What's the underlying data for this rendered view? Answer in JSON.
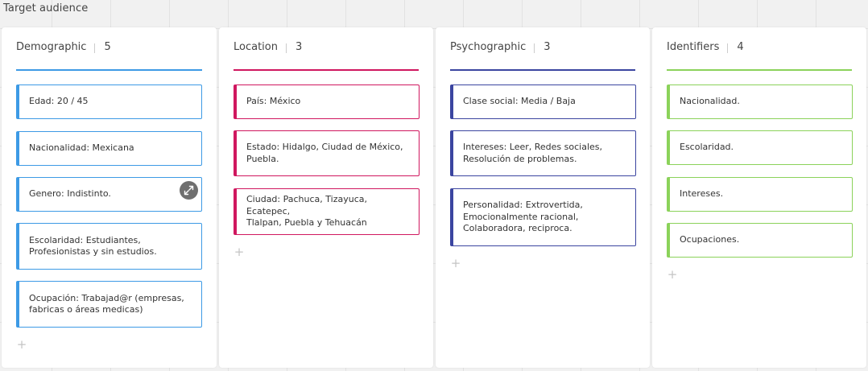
{
  "board": {
    "title": "Target audience"
  },
  "columns": [
    {
      "title": "Demographic",
      "count": "5",
      "accent": "#3d9ae5",
      "cards": [
        {
          "text": "Edad: 20 / 45"
        },
        {
          "text": "Nacionalidad: Mexicana"
        },
        {
          "text": "Genero: Indistinto."
        },
        {
          "text": "Escolaridad: Estudiantes,\nProfesionistas y sin estudios."
        },
        {
          "text": "Ocupación: Trabajad@r (empresas,\nfabricas o áreas medicas)"
        }
      ]
    },
    {
      "title": "Location",
      "count": "3",
      "accent": "#d0175f",
      "cards": [
        {
          "text": "País: México"
        },
        {
          "text": "Estado: Hidalgo, Ciudad de México,\nPuebla."
        },
        {
          "text": "Ciudad: Pachuca, Tizayuca, Ecatepec,\nTlalpan, Puebla y Tehuacán"
        }
      ]
    },
    {
      "title": "Psychographic",
      "count": "3",
      "accent": "#3b45a0",
      "cards": [
        {
          "text": "Clase social: Media / Baja"
        },
        {
          "text": "Intereses: Leer, Redes sociales,\nResolución de problemas."
        },
        {
          "text": "Personalidad: Extrovertida,\nEmocionalmente racional,\nColaboradora, reciproca."
        }
      ]
    },
    {
      "title": "Identifiers",
      "count": "4",
      "accent": "#8bd25a",
      "cards": [
        {
          "text": "Nacionalidad."
        },
        {
          "text": "Escolaridad."
        },
        {
          "text": "Intereses."
        },
        {
          "text": "Ocupaciones."
        }
      ]
    }
  ],
  "icons": {
    "expand": "expand-icon",
    "add": "plus-icon"
  },
  "add_label": "+"
}
